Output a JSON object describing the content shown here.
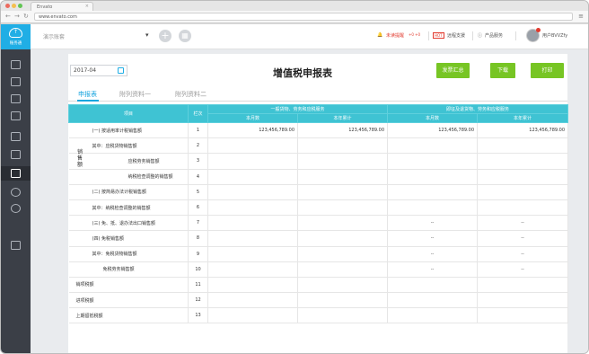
{
  "browser": {
    "tab_title": "Envato",
    "url": "www.envato.com"
  },
  "sidebar": {
    "logo_text": "账务通",
    "icons": [
      "grid-icon",
      "voucher-icon",
      "chart-icon",
      "ledger-icon",
      "tax-icon",
      "invoice-icon",
      "report-icon",
      "user-icon",
      "settings-icon",
      "document-icon"
    ]
  },
  "topbar": {
    "company_placeholder": "演示账套",
    "notice": "未读提醒",
    "notice_count": "+0 +0",
    "support": "远程支援",
    "product": "产品服务",
    "user": "用户BVVZfy"
  },
  "toolbar": {
    "period": "2017-04",
    "title": "增值税申报表",
    "btn_summary": "发票汇总",
    "btn_download": "下载",
    "btn_print": "打印"
  },
  "tabs": [
    "申报表",
    "附列资料一",
    "附列资料二"
  ],
  "table": {
    "h_item": "项目",
    "h_row": "栏次",
    "h_group1": "一般货物、劳务和应税服务",
    "h_group2": "即征及退货物、劳务和应税服务",
    "h_month": "本月数",
    "h_year": "本年累计",
    "side_label": "销售额",
    "rows": [
      {
        "label": "(一) 按适用率计税销售额",
        "no": "1",
        "c1": "123,456,789.00",
        "c2": "123,456,789.00",
        "c3": "123,456,789.00",
        "c4": "123,456,789.00"
      },
      {
        "label": "其中：应税货物销售额",
        "no": "2",
        "c1": "",
        "c2": "",
        "c3": "",
        "c4": ""
      },
      {
        "label": "应税劳务销售额",
        "no": "3",
        "c1": "",
        "c2": "",
        "c3": "",
        "c4": ""
      },
      {
        "label": "纳税检查调整的销售额",
        "no": "4",
        "c1": "",
        "c2": "",
        "c3": "",
        "c4": ""
      },
      {
        "label": "(二) 按简易办法计税销售额",
        "no": "5",
        "c1": "",
        "c2": "",
        "c3": "",
        "c4": ""
      },
      {
        "label": "其中：纳税检查调整的销售额",
        "no": "6",
        "c1": "",
        "c2": "",
        "c3": "",
        "c4": ""
      },
      {
        "label": "(三) 免、抵、退办法出口销售额",
        "no": "7",
        "c1": "",
        "c2": "",
        "c3": "--",
        "c4": "--"
      },
      {
        "label": "(四) 免税销售额",
        "no": "8",
        "c1": "",
        "c2": "",
        "c3": "--",
        "c4": "--"
      },
      {
        "label": "其中：免税货物销售额",
        "no": "9",
        "c1": "",
        "c2": "",
        "c3": "--",
        "c4": "--"
      },
      {
        "label": "免税劳务销售额",
        "no": "10",
        "c1": "",
        "c2": "",
        "c3": "--",
        "c4": "--"
      },
      {
        "label": "销项税额",
        "no": "11",
        "c1": "",
        "c2": "",
        "c3": "",
        "c4": ""
      },
      {
        "label": "进项税额",
        "no": "12",
        "c1": "",
        "c2": "",
        "c3": "",
        "c4": ""
      },
      {
        "label": "上期留抵税额",
        "no": "13",
        "c1": "",
        "c2": "",
        "c3": "",
        "c4": ""
      }
    ]
  },
  "colors": {
    "accent": "#20aee5",
    "header": "#3fc3d3",
    "button": "#77c524",
    "sidebar": "#3b3f47"
  }
}
